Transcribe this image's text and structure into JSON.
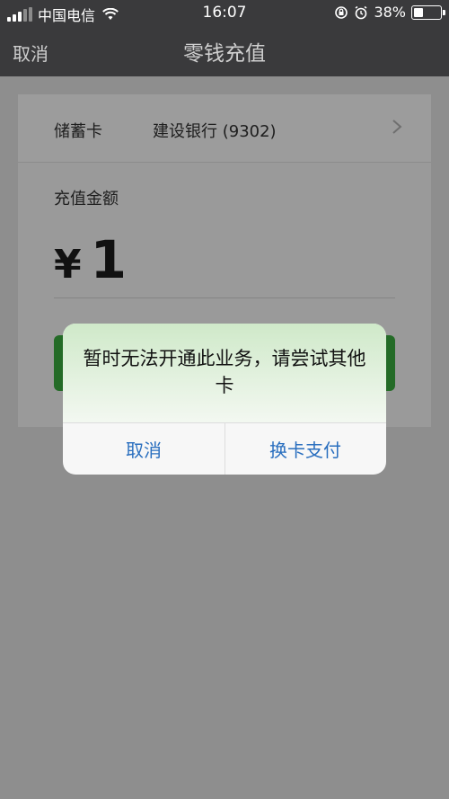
{
  "status_bar": {
    "carrier": "中国电信",
    "time": "16:07",
    "battery_percent": "38%",
    "battery_level": 0.38
  },
  "nav": {
    "cancel_label": "取消",
    "title": "零钱充值"
  },
  "card": {
    "card_type_label": "储蓄卡",
    "bank_value": "建设银行 (9302)",
    "amount_label": "充值金额",
    "currency_symbol": "¥",
    "amount_value": "1"
  },
  "alert": {
    "message": "暂时无法开通此业务，请尝试其他卡",
    "cancel_label": "取消",
    "switch_card_label": "换卡支付"
  },
  "colors": {
    "accent_button": "#2a6fbf",
    "confirm_green": "#246b27"
  }
}
